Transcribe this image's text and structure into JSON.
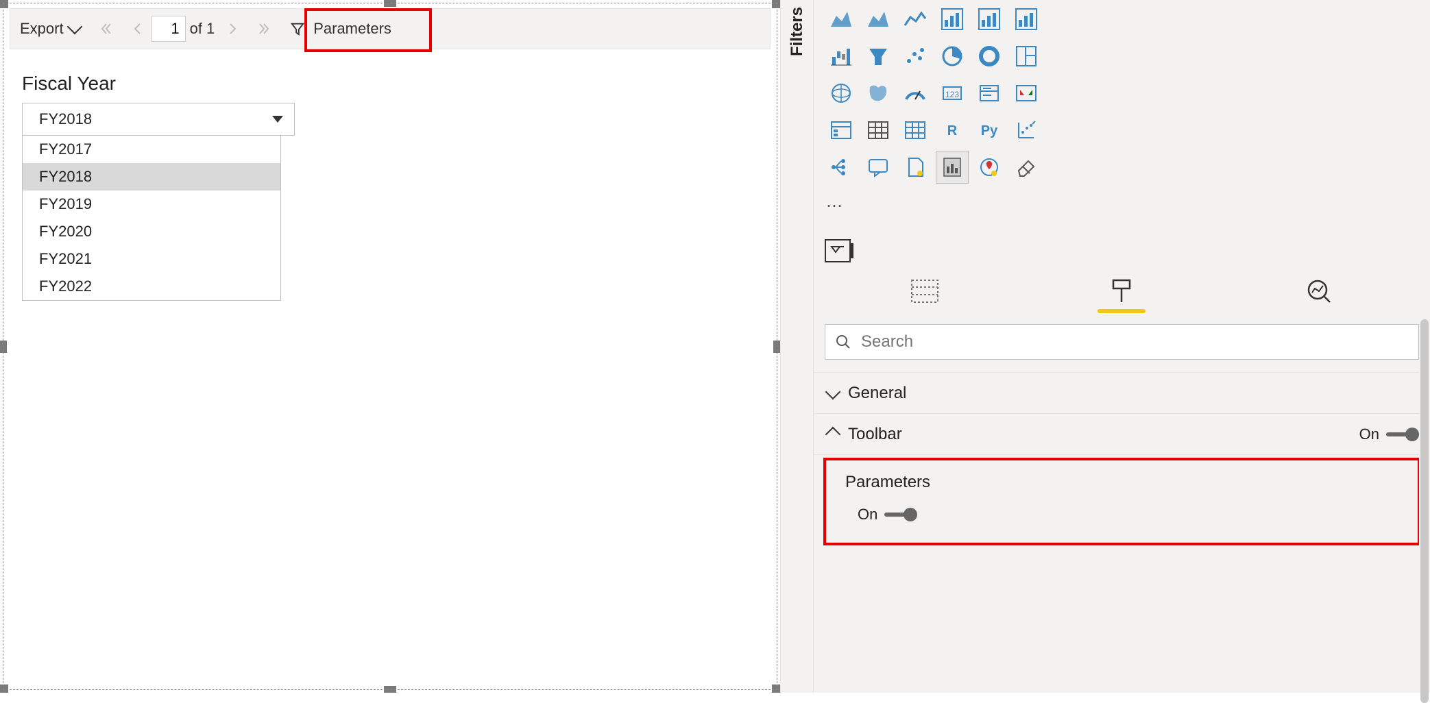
{
  "toolbar": {
    "export_label": "Export",
    "page_current": "1",
    "page_of": "of",
    "page_total": "1",
    "parameters_label": "Parameters"
  },
  "report": {
    "param_label": "Fiscal Year",
    "selected": "FY2018",
    "options": [
      "FY2017",
      "FY2018",
      "FY2019",
      "FY2020",
      "FY2021",
      "FY2022"
    ],
    "selected_index": 1
  },
  "filters_pane_label": "Filters",
  "viz": {
    "icons": [
      "area-chart-icon",
      "stacked-area-chart-icon",
      "line-chart-icon",
      "combo-chart-icon",
      "ribbon-chart-icon",
      "clustered-column-icon",
      "waterfall-chart-icon",
      "funnel-chart-icon",
      "scatter-chart-icon",
      "pie-chart-icon",
      "donut-chart-icon",
      "treemap-icon",
      "map-icon",
      "filled-map-icon",
      "gauge-icon",
      "card-icon",
      "multi-row-card-icon",
      "kpi-icon",
      "slicer-icon",
      "table-icon",
      "matrix-icon",
      "r-visual-icon",
      "python-visual-icon",
      "key-influencers-icon",
      "decomposition-tree-icon",
      "qa-icon",
      "smart-narrative-icon",
      "paginated-report-icon",
      "arcgis-map-icon",
      "powerapps-icon"
    ],
    "ellipsis": "⋯",
    "r_label": "R",
    "py_label": "Py"
  },
  "format": {
    "search_placeholder": "Search",
    "general_label": "General",
    "toolbar_label": "Toolbar",
    "toolbar_state": "On",
    "parameters_label": "Parameters",
    "parameters_state": "On"
  }
}
